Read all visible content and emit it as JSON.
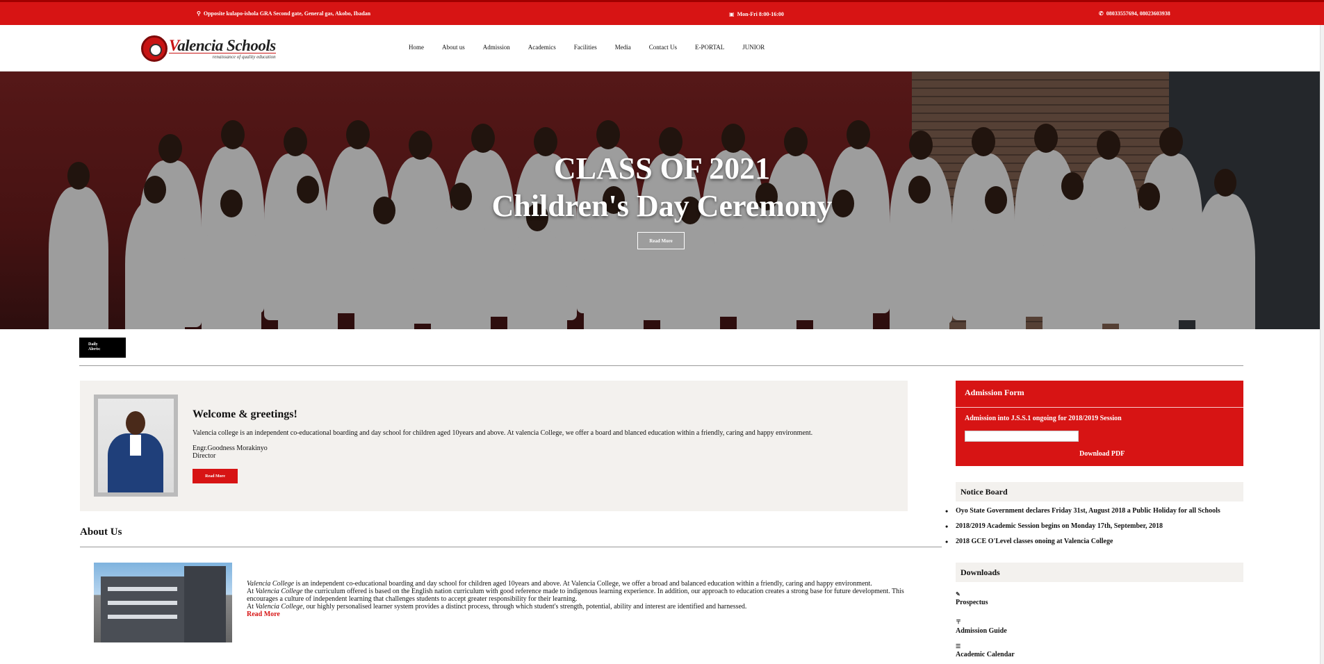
{
  "topbar": {
    "address": "Opposite kulapo-ishola GRA Second gate, General gas, Akobo, Ibadan",
    "hours": "Mon-Fri 8:00-16:00",
    "phones": "08033557694, 08023603938",
    "address_icon": "location-pin-icon",
    "hours_icon": "calendar-icon",
    "phone_icon": "phone-icon"
  },
  "logo": {
    "name_v": "V",
    "name_rest": "alencia",
    "name_schools": "Schools",
    "tagline": "renaissance of quality education"
  },
  "nav": {
    "items": [
      "Home",
      "About us",
      "Admission",
      "Academics",
      "Facilities",
      "Media",
      "Contact Us",
      "E-PORTAL",
      "JUNIOR"
    ]
  },
  "hero": {
    "title_line1": "CLASS OF 2021",
    "title_line2": "Children's Day Ceremony",
    "button": "Read More"
  },
  "alerts": {
    "label_line1": "Daily",
    "label_line2": "Alerts:"
  },
  "welcome": {
    "title": "Welcome & greetings!",
    "text": "Valencia college is an independent co-educational boarding and day school for children aged 10years and above. At valencia College, we offer a board and blanced education within a friendly, caring and happy environment.",
    "name": "Engr.Goodness Morakinyo",
    "role": "Director",
    "button": "Read More"
  },
  "about": {
    "title": "About Us",
    "p1_italic": "Valencia College",
    "p1_rest": " is an independent co-educational boarding and day school for children aged 10years and above. At Valencia College, we offer a broad and balanced education within a friendly, caring and happy environment.",
    "p2_start": "At ",
    "p2_italic": "Valencia College",
    "p2_rest": " the curriculum offered is based on the English nation curriculum with good reference made to indigenous learning experience. In addition, our approach to education creates a strong base for future development. This encourages a culture of independent learning that challenges students to accept greater responsibility for their learning.",
    "p3_start": "At ",
    "p3_italic": "Valencia College,",
    "p3_rest": " our highly personalised learner system provides a distinct process, through which student's strength, potential, ability and interest are identified and harnessed.",
    "read_more": "Read More"
  },
  "admission_form": {
    "title": "Admission Form",
    "subtitle": "Admission into J.S.S.1 ongoing for 2018/2019 Session",
    "download": "Download PDF"
  },
  "notice_board": {
    "title": "Notice Board",
    "items": [
      "Oyo State Government declares Friday 31st, August 2018 a Public Holiday for all Schools",
      "2018/2019 Academic Session begins on Monday 17th, September, 2018",
      "2018 GCE O'Level classes onoing at Valencia College"
    ]
  },
  "downloads": {
    "title": "Downloads",
    "items": [
      {
        "label": "Prospectus",
        "icon": "paperclip-icon"
      },
      {
        "label": "Admission Guide",
        "icon": "pin-icon"
      },
      {
        "label": "Academic Calendar",
        "icon": "list-icon"
      }
    ]
  },
  "colors": {
    "brand_red": "#d71414",
    "panel_bg": "#f3f1ee"
  }
}
